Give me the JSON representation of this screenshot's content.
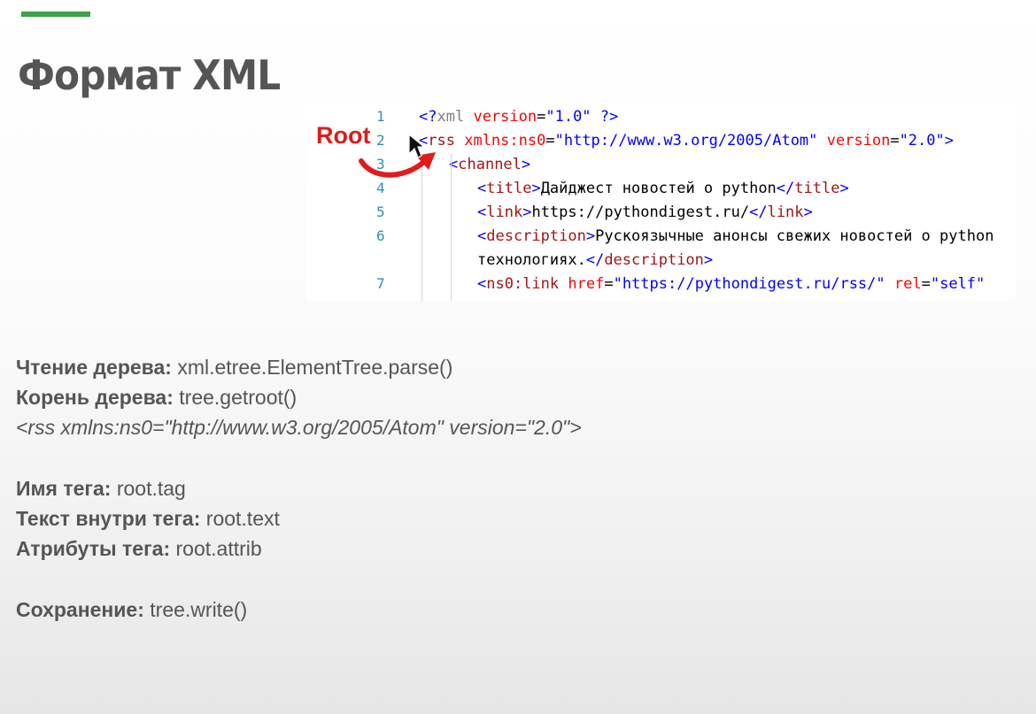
{
  "slide": {
    "title": "Формат XML",
    "accent_color": "#3aa447"
  },
  "code": {
    "lines": [
      {
        "num": "1",
        "tokens": [
          {
            "t": "punct",
            "v": "<?"
          },
          {
            "t": "pi",
            "v": "xml"
          },
          {
            "t": "text",
            "v": " "
          },
          {
            "t": "attr",
            "v": "version"
          },
          {
            "t": "text",
            "v": "="
          },
          {
            "t": "val",
            "v": "\"1.0\""
          },
          {
            "t": "text",
            "v": " "
          },
          {
            "t": "punct",
            "v": "?>"
          }
        ]
      },
      {
        "num": "2",
        "tokens": [
          {
            "t": "punct",
            "v": "<"
          },
          {
            "t": "tag",
            "v": "rss"
          },
          {
            "t": "text",
            "v": " "
          },
          {
            "t": "attr",
            "v": "xmlns:ns0"
          },
          {
            "t": "text",
            "v": "="
          },
          {
            "t": "val",
            "v": "\"http://www.w3.org/2005/Atom\""
          },
          {
            "t": "text",
            "v": " "
          },
          {
            "t": "attr",
            "v": "version"
          },
          {
            "t": "text",
            "v": "="
          },
          {
            "t": "val",
            "v": "\"2.0\""
          },
          {
            "t": "punct",
            "v": ">"
          }
        ]
      },
      {
        "num": "3",
        "tokens": [
          {
            "t": "punct",
            "v": "<"
          },
          {
            "t": "tag",
            "v": "channel"
          },
          {
            "t": "punct",
            "v": ">"
          }
        ]
      },
      {
        "num": "4",
        "tokens": [
          {
            "t": "punct",
            "v": "<"
          },
          {
            "t": "tag",
            "v": "title"
          },
          {
            "t": "punct",
            "v": ">"
          },
          {
            "t": "text",
            "v": "Дайджест новостей о python"
          },
          {
            "t": "punct",
            "v": "</"
          },
          {
            "t": "tag",
            "v": "title"
          },
          {
            "t": "punct",
            "v": ">"
          }
        ]
      },
      {
        "num": "5",
        "tokens": [
          {
            "t": "punct",
            "v": "<"
          },
          {
            "t": "tag",
            "v": "link"
          },
          {
            "t": "punct",
            "v": ">"
          },
          {
            "t": "text",
            "v": "https://pythondigest.ru/"
          },
          {
            "t": "punct",
            "v": "</"
          },
          {
            "t": "tag",
            "v": "link"
          },
          {
            "t": "punct",
            "v": ">"
          }
        ]
      },
      {
        "num": "6",
        "tokens": [
          {
            "t": "punct",
            "v": "<"
          },
          {
            "t": "tag",
            "v": "description"
          },
          {
            "t": "punct",
            "v": ">"
          },
          {
            "t": "text",
            "v": "Рускоязычные анонсы свежих новостей о python"
          }
        ]
      },
      {
        "num": "",
        "tokens": [
          {
            "t": "text",
            "v": "технологиях."
          },
          {
            "t": "punct",
            "v": "</"
          },
          {
            "t": "tag",
            "v": "description"
          },
          {
            "t": "punct",
            "v": ">"
          }
        ]
      },
      {
        "num": "7",
        "tokens": [
          {
            "t": "punct",
            "v": "<"
          },
          {
            "t": "tag",
            "v": "ns0:link"
          },
          {
            "t": "text",
            "v": " "
          },
          {
            "t": "attr",
            "v": "href"
          },
          {
            "t": "text",
            "v": "="
          },
          {
            "t": "val",
            "v": "\"https://pythondigest.ru/rss/\""
          },
          {
            "t": "text",
            "v": " "
          },
          {
            "t": "attr",
            "v": "rel"
          },
          {
            "t": "text",
            "v": "="
          },
          {
            "t": "val",
            "v": "\"self\""
          }
        ]
      }
    ]
  },
  "annotation": {
    "root_label": "Root",
    "color": "#e11b1b"
  },
  "notes": {
    "read_label": "Чтение дерева:",
    "read_value": "xml.etree.ElementTree.parse()",
    "root_label": "Корень дерева:",
    "root_value": "tree.getroot()",
    "root_example": "<rss xmlns:ns0=\"http://www.w3.org/2005/Atom\" version=\"2.0\">",
    "tag_label": "Имя тега:",
    "tag_value": "root.tag",
    "text_label": "Текст внутри тега:",
    "text_value": "root.text",
    "attr_label": "Атрибуты тега:",
    "attr_value": "root.attrib",
    "save_label": "Сохранение:",
    "save_value": "tree.write()"
  }
}
